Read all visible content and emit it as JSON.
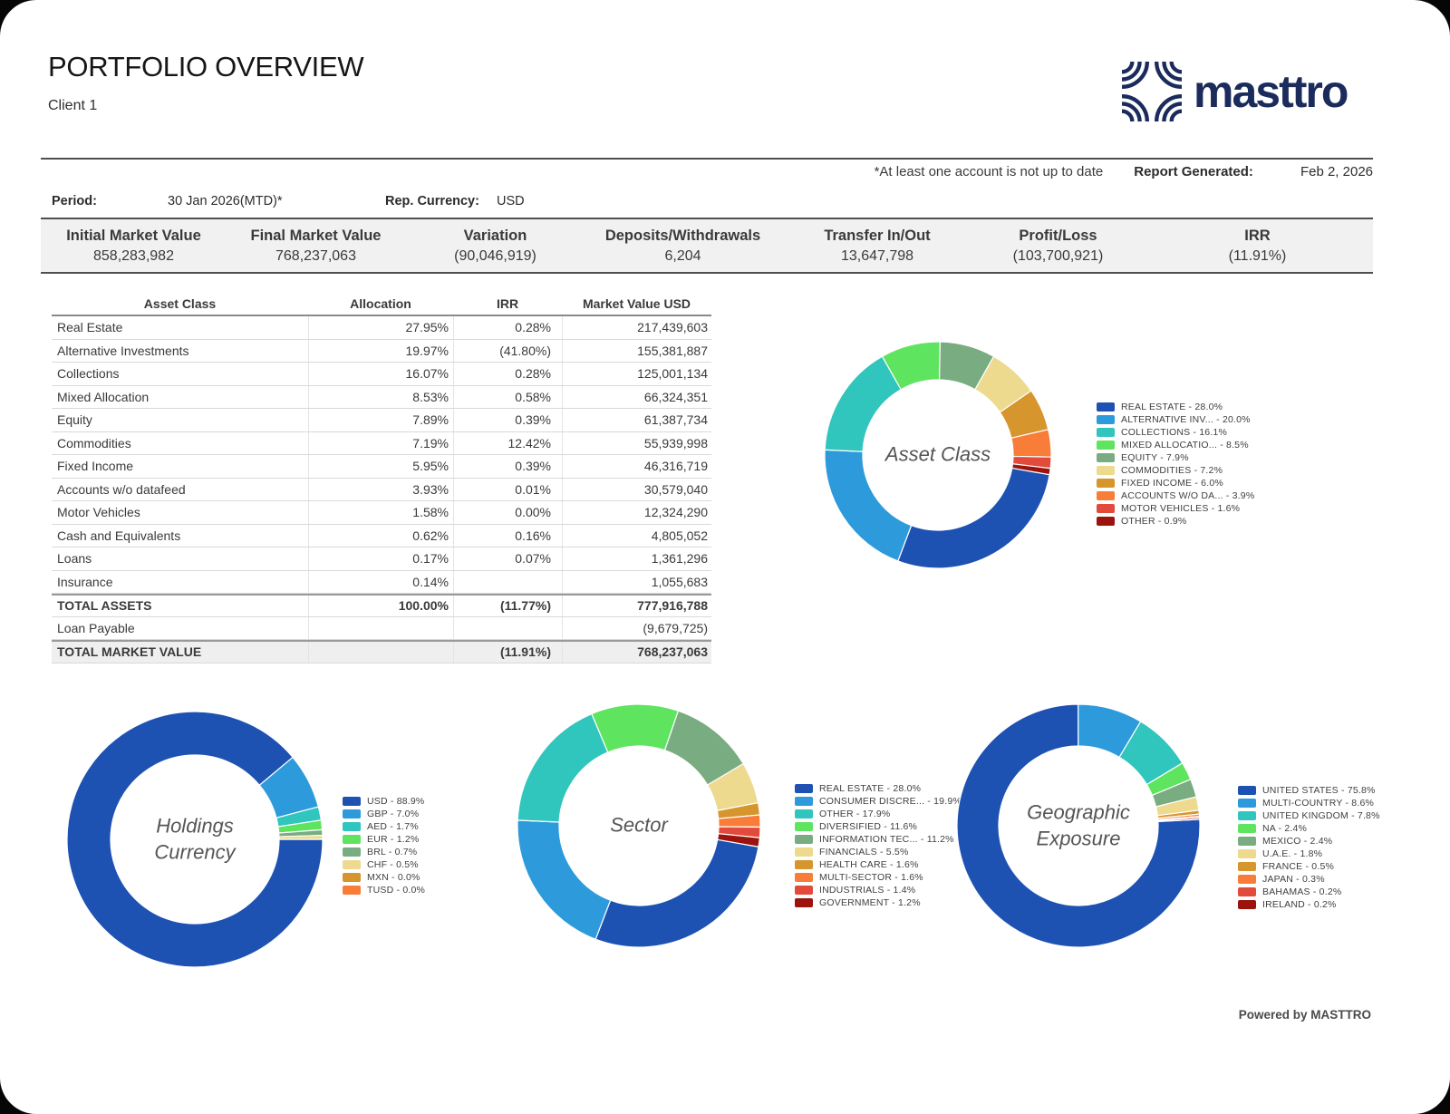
{
  "page": {
    "title": "PORTFOLIO OVERVIEW",
    "client": "Client 1",
    "brand": "masttro",
    "note": "*At least one account is not up to date",
    "report_generated_label": "Report Generated:",
    "report_generated_value": "Feb 2, 2026",
    "period_label": "Period:",
    "period_value": "30 Jan 2026(MTD)*",
    "rep_currency_label": "Rep. Currency:",
    "rep_currency_value": "USD",
    "footer": "Powered by MASTTRO"
  },
  "summary": {
    "columns": [
      {
        "label": "Initial Market Value",
        "value": "858,283,982"
      },
      {
        "label": "Final Market Value",
        "value": "768,237,063"
      },
      {
        "label": "Variation",
        "value": "(90,046,919)"
      },
      {
        "label": "Deposits/Withdrawals",
        "value": "6,204"
      },
      {
        "label": "Transfer In/Out",
        "value": "13,647,798"
      },
      {
        "label": "Profit/Loss",
        "value": "(103,700,921)"
      },
      {
        "label": "IRR",
        "value": "(11.91%)"
      }
    ]
  },
  "asset_table": {
    "headers": [
      "Asset Class",
      "Allocation",
      "IRR",
      "Market Value USD"
    ],
    "rows": [
      {
        "label": "Real Estate",
        "allocation": "27.95%",
        "irr": "0.28%",
        "value": "217,439,603",
        "style": "normal"
      },
      {
        "label": "Alternative Investments",
        "allocation": "19.97%",
        "irr": "(41.80%)",
        "value": "155,381,887",
        "style": "normal"
      },
      {
        "label": "Collections",
        "allocation": "16.07%",
        "irr": "0.28%",
        "value": "125,001,134",
        "style": "normal"
      },
      {
        "label": "Mixed Allocation",
        "allocation": "8.53%",
        "irr": "0.58%",
        "value": "66,324,351",
        "style": "normal"
      },
      {
        "label": "Equity",
        "allocation": "7.89%",
        "irr": "0.39%",
        "value": "61,387,734",
        "style": "normal"
      },
      {
        "label": "Commodities",
        "allocation": "7.19%",
        "irr": "12.42%",
        "value": "55,939,998",
        "style": "normal"
      },
      {
        "label": "Fixed Income",
        "allocation": "5.95%",
        "irr": "0.39%",
        "value": "46,316,719",
        "style": "normal"
      },
      {
        "label": "Accounts w/o datafeed",
        "allocation": "3.93%",
        "irr": "0.01%",
        "value": "30,579,040",
        "style": "normal"
      },
      {
        "label": "Motor Vehicles",
        "allocation": "1.58%",
        "irr": "0.00%",
        "value": "12,324,290",
        "style": "normal"
      },
      {
        "label": "Cash and Equivalents",
        "allocation": "0.62%",
        "irr": "0.16%",
        "value": "4,805,052",
        "style": "normal"
      },
      {
        "label": "Loans",
        "allocation": "0.17%",
        "irr": "0.07%",
        "value": "1,361,296",
        "style": "normal"
      },
      {
        "label": "Insurance",
        "allocation": "0.14%",
        "irr": "",
        "value": "1,055,683",
        "style": "normal"
      },
      {
        "label": "TOTAL ASSETS",
        "allocation": "100.00%",
        "irr": "(11.77%)",
        "value": "777,916,788",
        "style": "total"
      },
      {
        "label": "Loan Payable",
        "allocation": "",
        "irr": "",
        "value": "(9,679,725)",
        "style": "normal"
      },
      {
        "label": "TOTAL MARKET VALUE",
        "allocation": "",
        "irr": "(11.91%)",
        "value": "768,237,063",
        "style": "grand"
      }
    ]
  },
  "chart_data": [
    {
      "type": "donut",
      "key": "asset",
      "center_label": "Asset Class",
      "start_angle": 100,
      "items": [
        {
          "label": "REAL ESTATE",
          "value": 28.0
        },
        {
          "label": "ALTERNATIVE INV...",
          "value": 20.0
        },
        {
          "label": "COLLECTIONS",
          "value": 16.1
        },
        {
          "label": "MIXED ALLOCATIO...",
          "value": 8.5
        },
        {
          "label": "EQUITY",
          "value": 7.9
        },
        {
          "label": "COMMODITIES",
          "value": 7.2
        },
        {
          "label": "FIXED INCOME",
          "value": 6.0
        },
        {
          "label": "ACCOUNTS W/O DA...",
          "value": 3.9
        },
        {
          "label": "MOTOR VEHICLES",
          "value": 1.6
        },
        {
          "label": "OTHER",
          "value": 0.9
        }
      ]
    },
    {
      "type": "donut",
      "key": "currency",
      "center_label": "Holdings Currency",
      "start_angle": 90,
      "items": [
        {
          "label": "USD",
          "value": 88.9
        },
        {
          "label": "GBP",
          "value": 7.0
        },
        {
          "label": "AED",
          "value": 1.7
        },
        {
          "label": "EUR",
          "value": 1.2
        },
        {
          "label": "BRL",
          "value": 0.7
        },
        {
          "label": "CHF",
          "value": 0.5
        },
        {
          "label": "MXN",
          "value": 0.0
        },
        {
          "label": "TUSD",
          "value": 0.0
        }
      ]
    },
    {
      "type": "donut",
      "key": "sector",
      "center_label": "Sector",
      "start_angle": 100,
      "items": [
        {
          "label": "REAL ESTATE",
          "value": 28.0
        },
        {
          "label": "CONSUMER DISCRE...",
          "value": 19.9
        },
        {
          "label": "OTHER",
          "value": 17.9
        },
        {
          "label": "DIVERSIFIED",
          "value": 11.6
        },
        {
          "label": "INFORMATION TEC...",
          "value": 11.2
        },
        {
          "label": "FINANCIALS",
          "value": 5.5
        },
        {
          "label": "HEALTH CARE",
          "value": 1.6
        },
        {
          "label": "MULTI-SECTOR",
          "value": 1.6
        },
        {
          "label": "INDUSTRIALS",
          "value": 1.4
        },
        {
          "label": "GOVERNMENT",
          "value": 1.2
        }
      ]
    },
    {
      "type": "donut",
      "key": "geo",
      "center_label": "Geographic Exposure",
      "start_angle": 87,
      "items": [
        {
          "label": "UNITED STATES",
          "value": 75.8
        },
        {
          "label": "MULTI-COUNTRY",
          "value": 8.6
        },
        {
          "label": "UNITED KINGDOM",
          "value": 7.8
        },
        {
          "label": "NA",
          "value": 2.4
        },
        {
          "label": "MEXICO",
          "value": 2.4
        },
        {
          "label": "U.A.E.",
          "value": 1.8
        },
        {
          "label": "FRANCE",
          "value": 0.5
        },
        {
          "label": "JAPAN",
          "value": 0.3
        },
        {
          "label": "BAHAMAS",
          "value": 0.2
        },
        {
          "label": "IRELAND",
          "value": 0.2
        }
      ]
    }
  ],
  "colors": {
    "palette": [
      "#1D51B2",
      "#2D9BDB",
      "#30C5BD",
      "#5FE45F",
      "#79AC80",
      "#EDDA8F",
      "#D6952D",
      "#F87D38",
      "#E24B3B",
      "#9C120D"
    ],
    "brand_navy": "#1B2B5C",
    "summary_bg": "#F1F1F1"
  }
}
